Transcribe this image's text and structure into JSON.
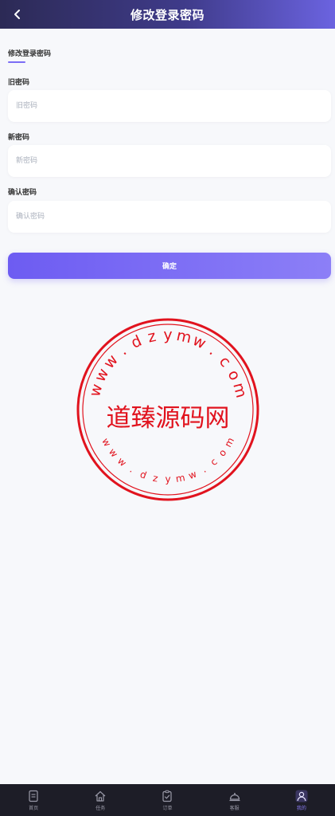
{
  "header": {
    "title": "修改登录密码"
  },
  "section": {
    "title": "修改登录密码"
  },
  "fields": [
    {
      "label": "旧密码",
      "placeholder": "旧密码",
      "value": ""
    },
    {
      "label": "新密码",
      "placeholder": "新密码",
      "value": ""
    },
    {
      "label": "确认密码",
      "placeholder": "确认密码",
      "value": ""
    }
  ],
  "confirm_label": "确定",
  "watermark": {
    "main": "道臻源码网",
    "url": "www.dzymw.com",
    "color": "#e1131e"
  },
  "tabs": [
    {
      "label": "首页",
      "icon": "document-icon",
      "active": false
    },
    {
      "label": "任务",
      "icon": "home-icon",
      "active": false
    },
    {
      "label": "订单",
      "icon": "clipboard-check-icon",
      "active": false
    },
    {
      "label": "客服",
      "icon": "service-bell-icon",
      "active": false
    },
    {
      "label": "我的",
      "icon": "user-icon",
      "active": true
    }
  ],
  "colors": {
    "accent": "#7b6df5",
    "tabbar": "#1d1d27"
  }
}
